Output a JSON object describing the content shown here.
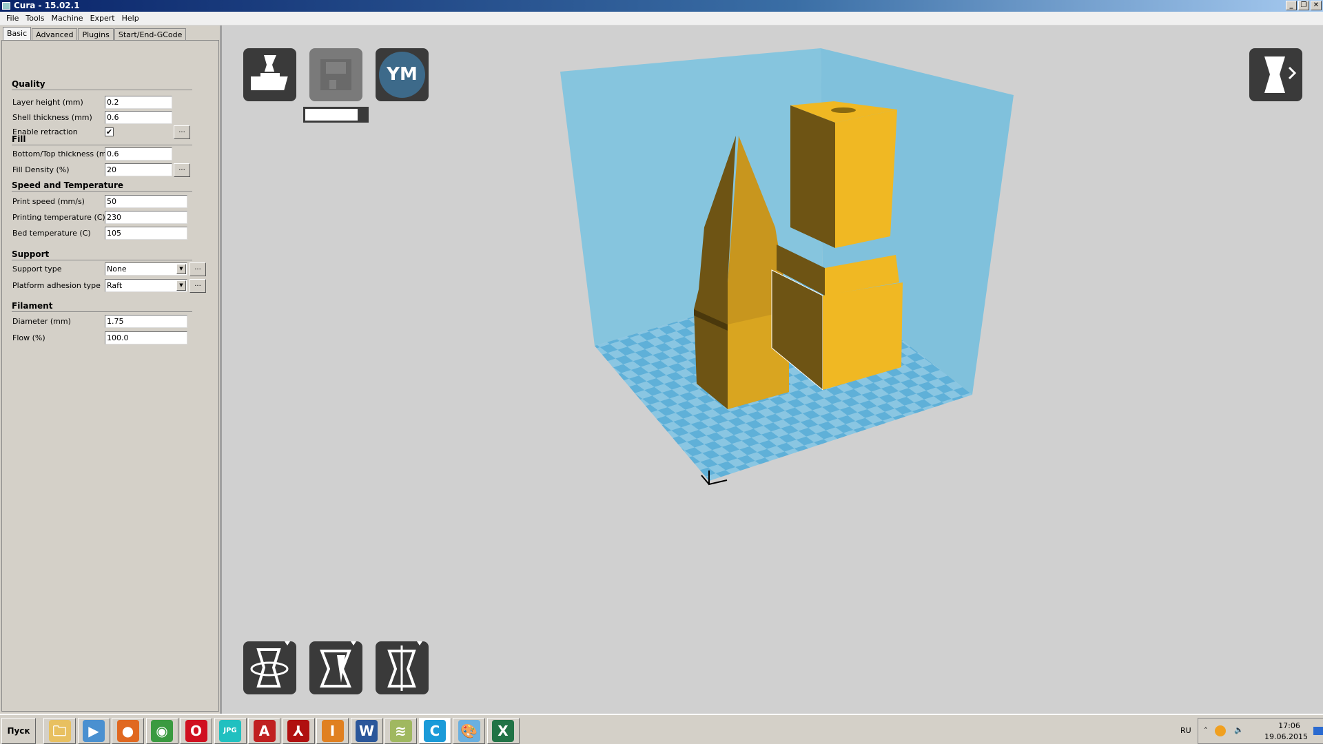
{
  "window": {
    "title": "Cura - 15.02.1",
    "controls": [
      "_",
      "❐",
      "✕"
    ]
  },
  "menu": [
    "File",
    "Tools",
    "Machine",
    "Expert",
    "Help"
  ],
  "tabs": [
    "Basic",
    "Advanced",
    "Plugins",
    "Start/End-GCode"
  ],
  "sections": [
    {
      "title": "Quality",
      "rows": [
        {
          "label": "Layer height (mm)",
          "value": "0.2",
          "kind": "text",
          "w": "short"
        },
        {
          "label": "Shell thickness (mm)",
          "value": "0.6",
          "kind": "text",
          "w": "short"
        },
        {
          "label": "Enable retraction",
          "value": "✔",
          "kind": "check",
          "checked": true,
          "more": "..."
        }
      ]
    },
    {
      "title": "Fill",
      "rows": [
        {
          "label": "Bottom/Top thickness (mm)",
          "value": "0.6",
          "kind": "text",
          "w": "short"
        },
        {
          "label": "Fill Density (%)",
          "value": "20",
          "kind": "text",
          "w": "short",
          "more": "..."
        }
      ]
    },
    {
      "title": "Speed and Temperature",
      "rows": [
        {
          "label": "Print speed (mm/s)",
          "value": "50",
          "kind": "text",
          "w": "long"
        },
        {
          "label": "Printing temperature (C)",
          "value": "230",
          "kind": "text",
          "w": "long"
        },
        {
          "label": "Bed temperature (C)",
          "value": "105",
          "kind": "text",
          "w": "long"
        }
      ]
    },
    {
      "title": "Support",
      "rows": [
        {
          "label": "Support type",
          "value": "None",
          "kind": "select",
          "more": "..."
        },
        {
          "label": "Platform adhesion type",
          "value": "Raft",
          "kind": "select",
          "more": "..."
        }
      ]
    },
    {
      "title": "Filament",
      "rows": [
        {
          "label": "Diameter (mm)",
          "value": "1.75",
          "kind": "text",
          "w": "long"
        },
        {
          "label": "Flow (%)",
          "value": "100.0",
          "kind": "text",
          "w": "long"
        }
      ]
    }
  ],
  "toolbar": {
    "load": "load-model-icon",
    "save": "save-gcode-icon",
    "ym_label": "YM",
    "progress": 0.85,
    "view_mode": "view-mode-icon"
  },
  "model_tools": [
    "rotate-icon",
    "scale-icon",
    "mirror-icon"
  ],
  "colors": {
    "model": "#f0b823",
    "model_dark": "#6e5414",
    "build_volume": "#86c5de",
    "bed": "#5fb0d8",
    "ym": "#3d6a8a"
  },
  "taskbar": {
    "start": "Пуск",
    "apps": [
      {
        "name": "explorer",
        "glyph": "🗀",
        "color": "#e8c060"
      },
      {
        "name": "media-player",
        "glyph": "▶",
        "color": "#4a90d0"
      },
      {
        "name": "firefox",
        "glyph": "●",
        "color": "#e06820"
      },
      {
        "name": "chrome",
        "glyph": "◉",
        "color": "#3a9a40"
      },
      {
        "name": "opera",
        "glyph": "O",
        "color": "#d01020"
      },
      {
        "name": "jpg-viewer",
        "glyph": "JPG",
        "color": "#20c0c0"
      },
      {
        "name": "autocad",
        "glyph": "A",
        "color": "#c02020"
      },
      {
        "name": "acrobat",
        "glyph": "⅄",
        "color": "#b01010"
      },
      {
        "name": "inventor",
        "glyph": "I",
        "color": "#e08020"
      },
      {
        "name": "word",
        "glyph": "W",
        "color": "#2b579a"
      },
      {
        "name": "app-green",
        "glyph": "≋",
        "color": "#a0b860"
      },
      {
        "name": "cura",
        "glyph": "C",
        "color": "#1a9ad8"
      },
      {
        "name": "paint",
        "glyph": "🎨",
        "color": "#6ab0e0"
      },
      {
        "name": "excel",
        "glyph": "X",
        "color": "#217346"
      }
    ]
  },
  "tray": {
    "lang": "RU",
    "time": "17:06",
    "date": "19.06.2015"
  }
}
